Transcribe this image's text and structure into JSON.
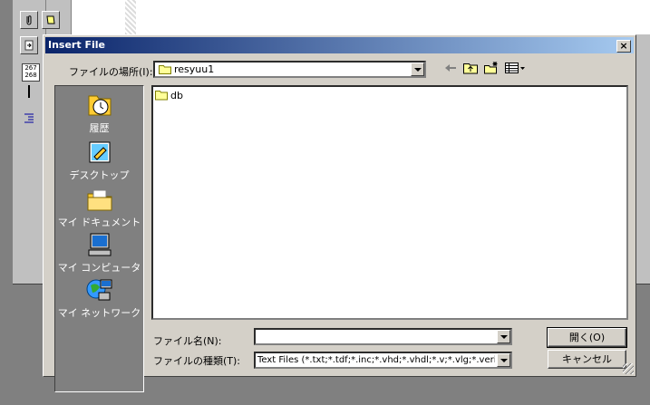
{
  "dialog": {
    "title": "Insert File",
    "close_label": "×"
  },
  "lookin": {
    "label": "ファイルの場所(I):",
    "value": "resyuu1"
  },
  "places": [
    {
      "label": "履歴",
      "icon": "history-icon"
    },
    {
      "label": "デスクトップ",
      "icon": "desktop-icon"
    },
    {
      "label": "マイ ドキュメント",
      "icon": "my-documents-icon"
    },
    {
      "label": "マイ コンピュータ",
      "icon": "my-computer-icon"
    },
    {
      "label": "マイ ネットワーク",
      "icon": "my-network-icon"
    }
  ],
  "files": [
    {
      "name": "db",
      "icon": "folder-icon"
    }
  ],
  "filename": {
    "label": "ファイル名(N):",
    "value": ""
  },
  "filetype": {
    "label": "ファイルの種類(T):",
    "value": "Text Files (*.txt;*.tdf;*.inc;*.vhd;*.vhdl;*.v;*.vlg;*.veril"
  },
  "buttons": {
    "open": "開く(O)",
    "cancel": "キャンセル"
  },
  "toolbar": {
    "line_numbers": "267\n268"
  },
  "colors": {
    "title_start": "#0a246a",
    "title_end": "#a6caf0",
    "dialog_face": "#d4d0c8"
  }
}
